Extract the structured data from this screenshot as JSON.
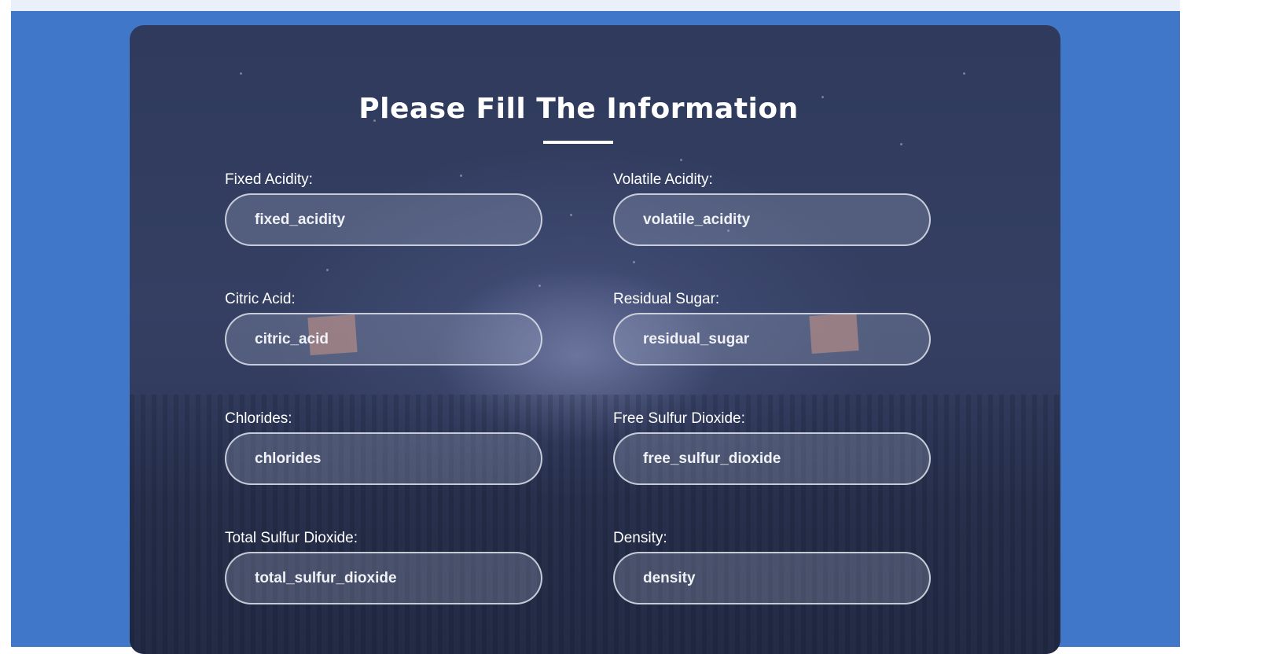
{
  "form": {
    "title": "Please Fill The Information",
    "fields": [
      {
        "label": "Fixed Acidity:",
        "placeholder": "fixed_acidity"
      },
      {
        "label": "Volatile Acidity:",
        "placeholder": "volatile_acidity"
      },
      {
        "label": "Citric Acid:",
        "placeholder": "citric_acid"
      },
      {
        "label": "Residual Sugar:",
        "placeholder": "residual_sugar"
      },
      {
        "label": "Chlorides:",
        "placeholder": "chlorides"
      },
      {
        "label": "Free Sulfur Dioxide:",
        "placeholder": "free_sulfur_dioxide"
      },
      {
        "label": "Total Sulfur Dioxide:",
        "placeholder": "total_sulfur_dioxide"
      },
      {
        "label": "Density:",
        "placeholder": "density"
      }
    ]
  },
  "colors": {
    "page_background": "#4177c9",
    "card_background": "#2f3a5c",
    "text": "#ffffff"
  }
}
